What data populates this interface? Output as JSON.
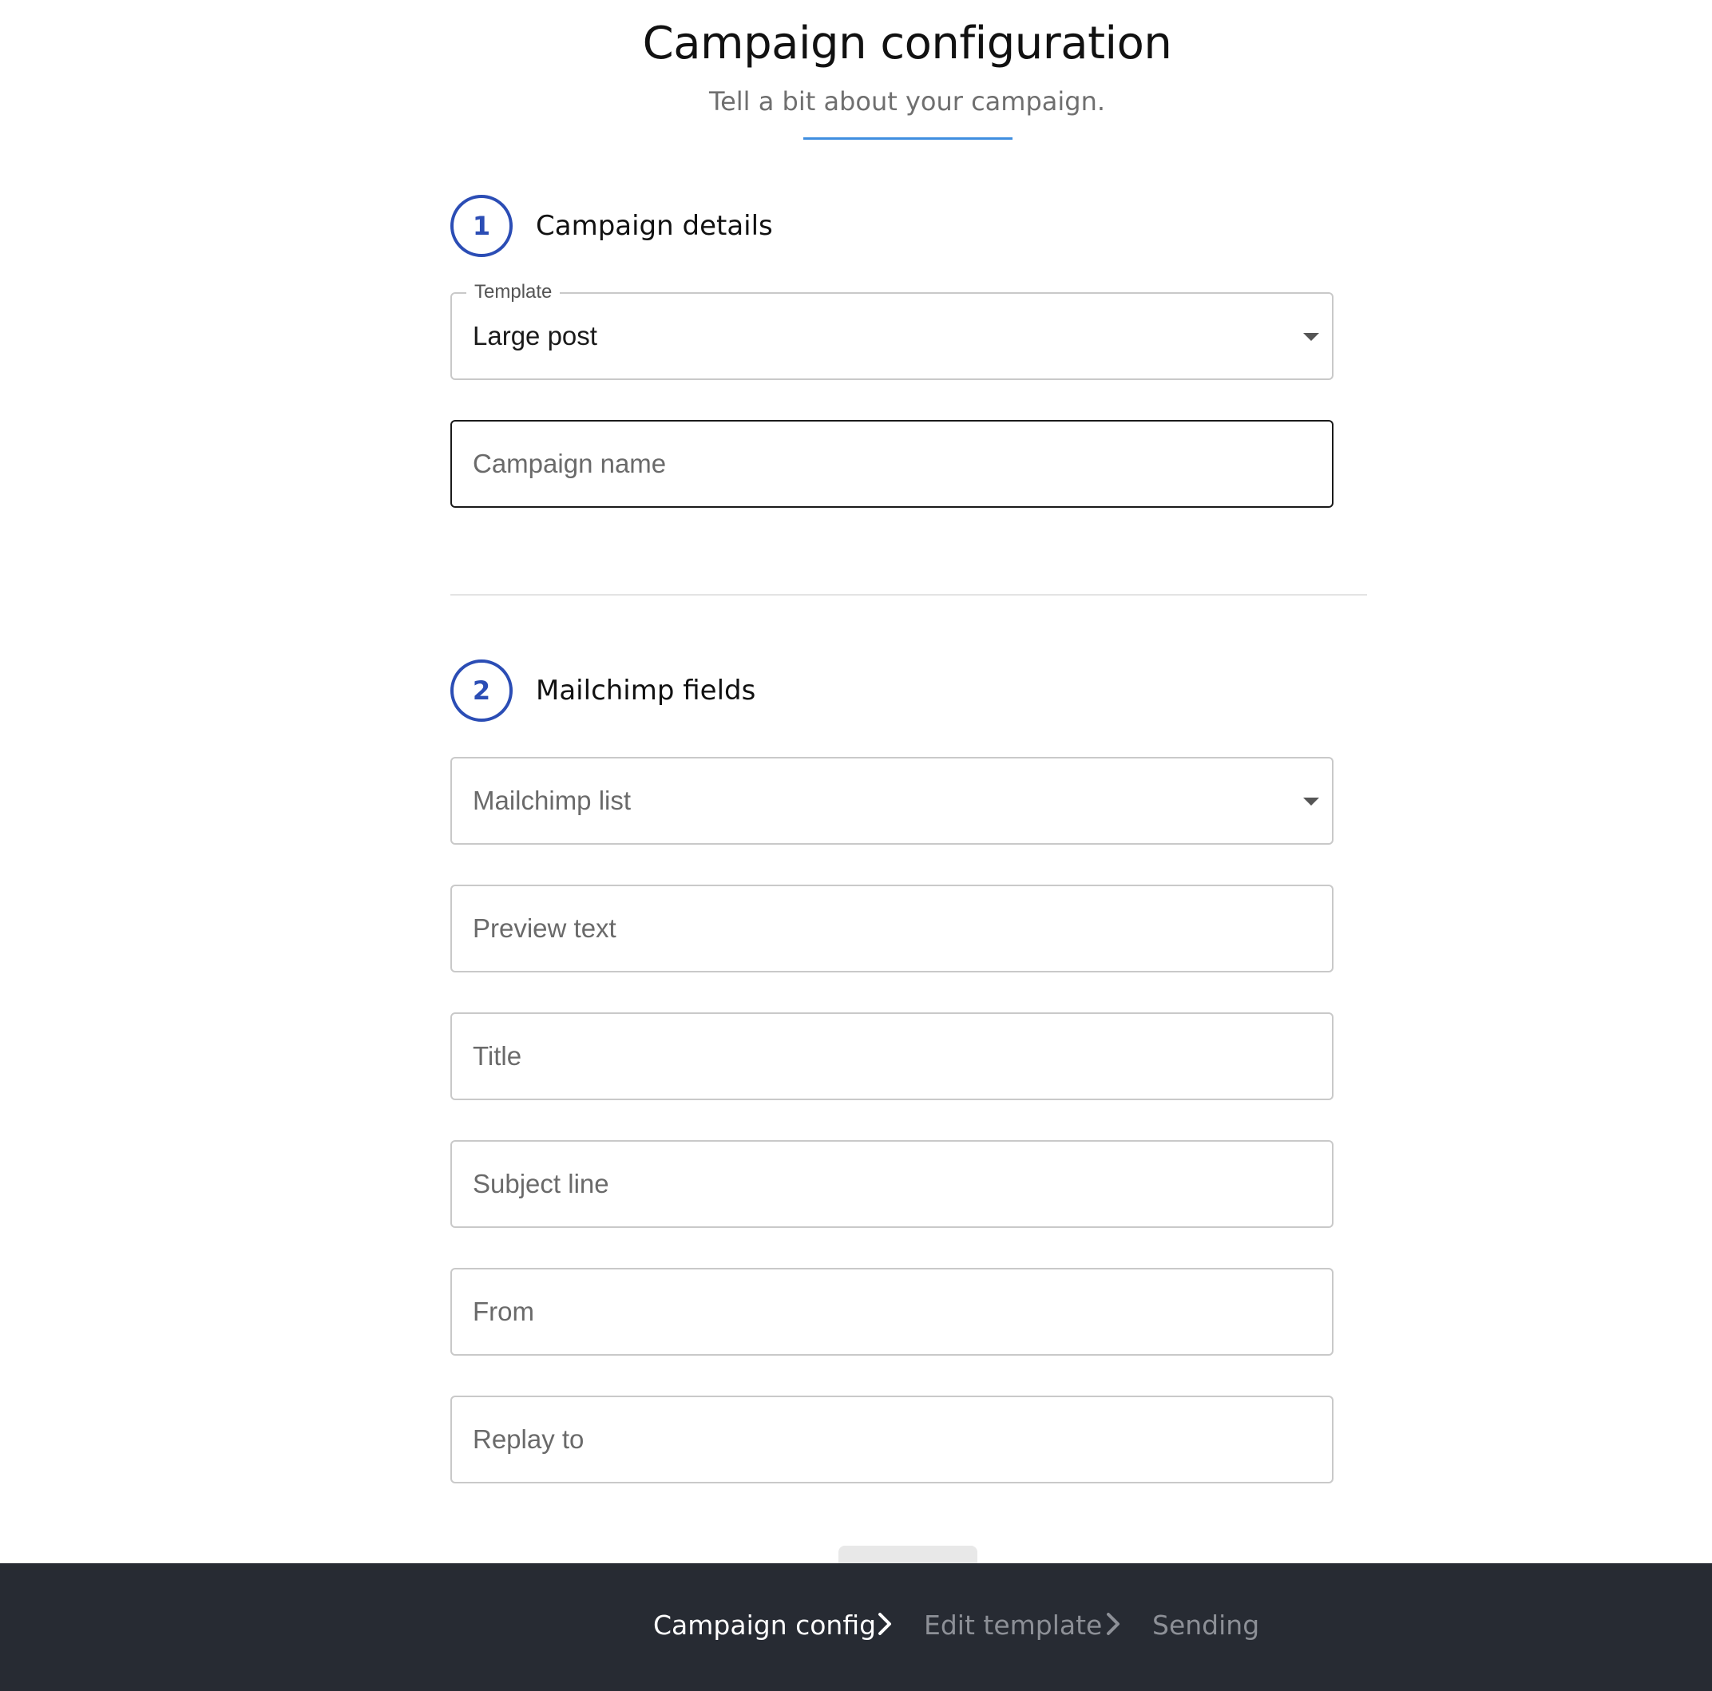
{
  "header": {
    "title": "Campaign configuration",
    "subtitle": "Tell a bit about your campaign."
  },
  "sections": [
    {
      "number": "1",
      "title": "Campaign details"
    },
    {
      "number": "2",
      "title": "Mailchimp fields"
    }
  ],
  "campaign_details": {
    "template": {
      "label": "Template",
      "value": "Large post"
    },
    "campaign_name": {
      "placeholder": "Campaign name",
      "value": ""
    }
  },
  "mailchimp_fields": {
    "list": {
      "placeholder": "Mailchimp list"
    },
    "preview_text": {
      "placeholder": "Preview text"
    },
    "title": {
      "placeholder": "Title"
    },
    "subject_line": {
      "placeholder": "Subject line"
    },
    "from": {
      "placeholder": "From"
    },
    "reply_to": {
      "placeholder": "Replay to"
    }
  },
  "footer": {
    "steps": [
      {
        "label": "Campaign config",
        "state": "active"
      },
      {
        "label": "Edit template",
        "state": "inactive"
      },
      {
        "label": "Sending",
        "state": "inactive"
      }
    ]
  },
  "colors": {
    "accent": "#2b4db5",
    "underline": "#3f8ee0",
    "footer_bg": "#272b33"
  },
  "icons": {
    "select_caret": "caret-down-icon",
    "breadcrumb_separator": "chevron-right-icon"
  }
}
